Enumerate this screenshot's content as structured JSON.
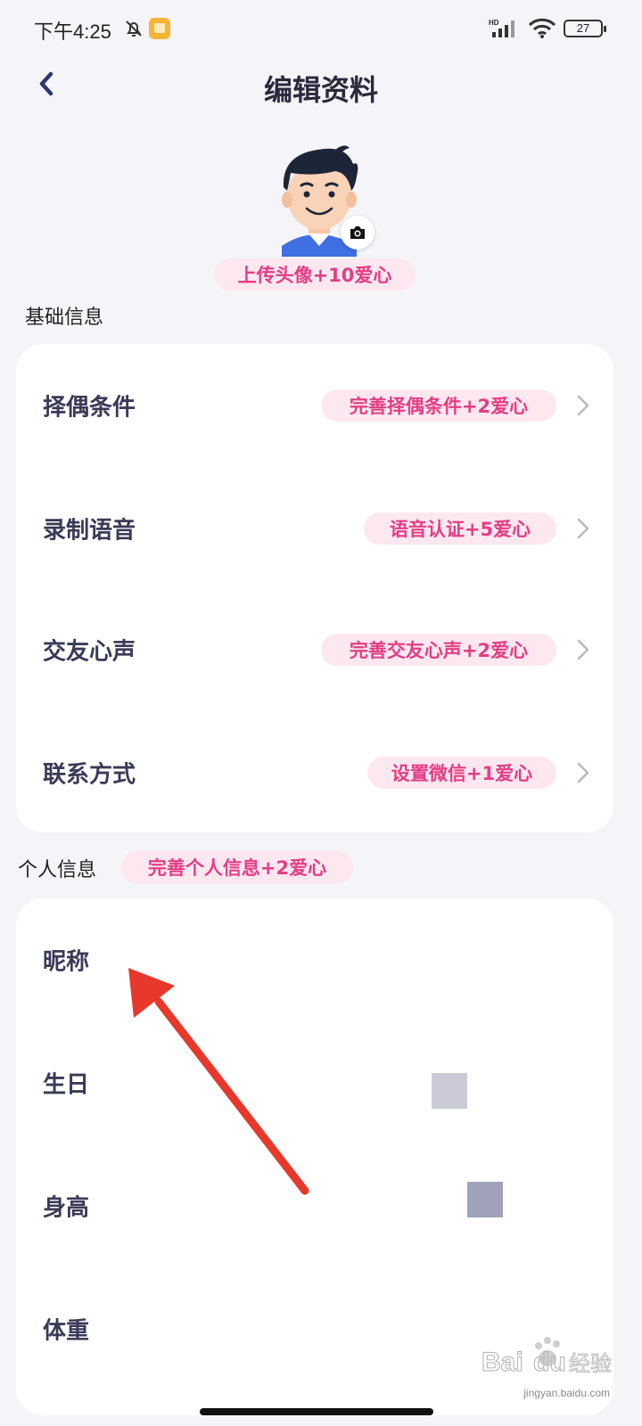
{
  "status_bar": {
    "time": "下午4:25",
    "network": "HD",
    "battery": "27"
  },
  "header": {
    "title": "编辑资料"
  },
  "avatar": {
    "upload_reward": "上传头像+10爱心"
  },
  "basic_info": {
    "section_title": "基础信息",
    "rows": [
      {
        "label": "择偶条件",
        "tag": "完善择偶条件+2爱心"
      },
      {
        "label": "录制语音",
        "tag": "语音认证+5爱心"
      },
      {
        "label": "交友心声",
        "tag": "完善交友心声+2爱心"
      },
      {
        "label": "联系方式",
        "tag": "设置微信+1爱心"
      }
    ]
  },
  "personal_info": {
    "section_title": "个人信息",
    "section_reward": "完善个人信息+2爱心",
    "rows": [
      {
        "label": "昵称"
      },
      {
        "label": "生日"
      },
      {
        "label": "身高"
      },
      {
        "label": "体重"
      }
    ]
  },
  "watermark": {
    "url": "jingyan.baidu.com"
  },
  "colors": {
    "accent_pink": "#e43d85",
    "pill_bg": "#fde8f0",
    "annotation_arrow": "#e8382b"
  }
}
